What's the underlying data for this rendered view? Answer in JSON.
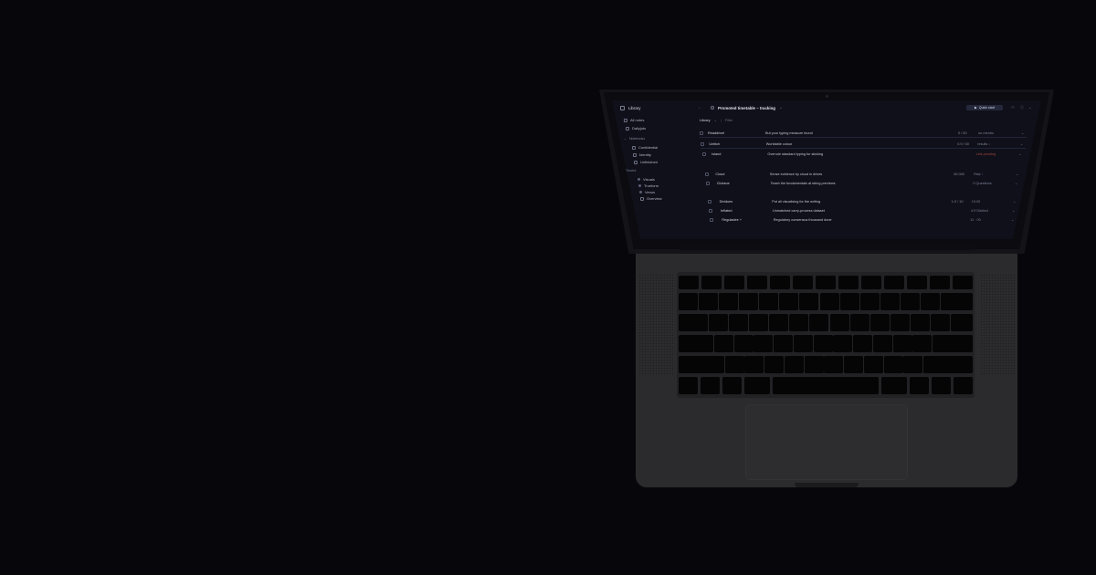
{
  "sidebar": {
    "title": "Library",
    "items": [
      {
        "label": "All notes"
      },
      {
        "label": "Dailyjots"
      }
    ],
    "groups": [
      {
        "label": "Notebooks",
        "items": [
          {
            "label": "Confidential"
          },
          {
            "label": "Identity"
          },
          {
            "label": "Unfinished"
          }
        ]
      },
      {
        "label": "Recent",
        "items": [
          {
            "label": "Visuals"
          },
          {
            "label": "Trueform"
          },
          {
            "label": "Venus"
          },
          {
            "label": "Overview"
          }
        ]
      }
    ]
  },
  "header": {
    "breadcrumb": "Promoted timetable – tracking",
    "share_label": "Quick start",
    "share_icon": "play-icon"
  },
  "filter": {
    "label": "Library",
    "secondary": "Filter"
  },
  "rows": [
    {
      "name": "Readdrivel",
      "desc": "But your typing measure found",
      "meta": "0 / 00",
      "tag": "un-mentio"
    },
    {
      "name": "Untitch",
      "desc": "Worktable colour",
      "meta": "0.9 / 00",
      "tag": "results ↓"
    },
    {
      "name": "Island",
      "desc": "Overrule standard typing for sticking",
      "meta": "",
      "tag": "Link pending"
    },
    {
      "name": "Cloud",
      "desc": "Sense evidence by cloud in drives",
      "meta": "00.000",
      "tag": "Risk ↑"
    },
    {
      "name": "Clubsoe",
      "desc": "Teach the fundamentals at string previews",
      "meta": "",
      "tag": "0 Questions"
    },
    {
      "name": "Dividues",
      "desc": "Put all visualising for the writing",
      "meta": "1.0 / 10",
      "tag": "10:00"
    },
    {
      "name": "Inflated",
      "desc": "Unmatched carry-process dataset",
      "meta": "",
      "tag": "4.9 Distinct"
    },
    {
      "name": "Reguladee +",
      "desc": "Regulatory consensus thousand done",
      "meta": "",
      "tag": "11 · 00"
    }
  ]
}
